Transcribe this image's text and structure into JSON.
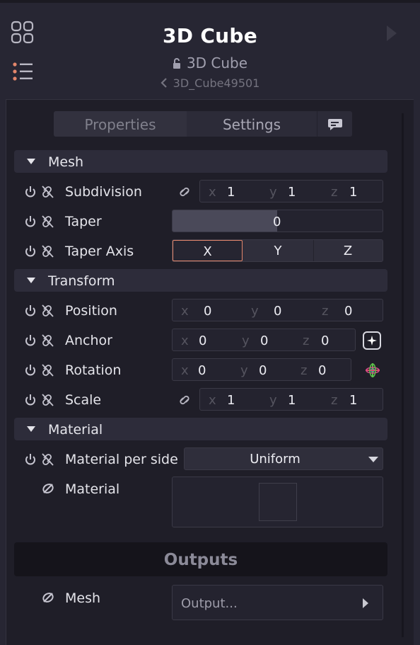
{
  "header": {
    "title": "3D Cube",
    "subtitle": "3D Cube",
    "instance_id": "3D_Cube49501"
  },
  "tabs": {
    "properties": "Properties",
    "settings": "Settings"
  },
  "sections": {
    "mesh": "Mesh",
    "transform": "Transform",
    "material": "Material",
    "outputs": "Outputs"
  },
  "mesh": {
    "subdivision": {
      "label": "Subdivision",
      "x_axis": "x",
      "x": "1",
      "y_axis": "y",
      "y": "1",
      "z_axis": "z",
      "z": "1"
    },
    "taper": {
      "label": "Taper",
      "value": "0"
    },
    "taper_axis": {
      "label": "Taper Axis",
      "options": [
        "X",
        "Y",
        "Z"
      ],
      "selected": "X"
    }
  },
  "transform": {
    "position": {
      "label": "Position",
      "x_axis": "x",
      "x": "0",
      "y_axis": "y",
      "y": "0",
      "z_axis": "z",
      "z": "0"
    },
    "anchor": {
      "label": "Anchor",
      "x_axis": "x",
      "x": "0",
      "y_axis": "y",
      "y": "0",
      "z_axis": "z",
      "z": "0"
    },
    "rotation": {
      "label": "Rotation",
      "x_axis": "x",
      "x": "0",
      "y_axis": "y",
      "y": "0",
      "z_axis": "z",
      "z": "0"
    },
    "scale": {
      "label": "Scale",
      "x_axis": "x",
      "x": "1",
      "y_axis": "y",
      "y": "1",
      "z_axis": "z",
      "z": "1"
    }
  },
  "material": {
    "per_side": {
      "label": "Material per side",
      "value": "Uniform"
    },
    "material": {
      "label": "Material"
    }
  },
  "outputs": {
    "mesh": {
      "label": "Mesh",
      "placeholder": "Output..."
    }
  },
  "colors": {
    "background": "#272633",
    "panel": "#1f1e28",
    "section": "#2d2c3a",
    "accent_selected": "#e3866b"
  }
}
